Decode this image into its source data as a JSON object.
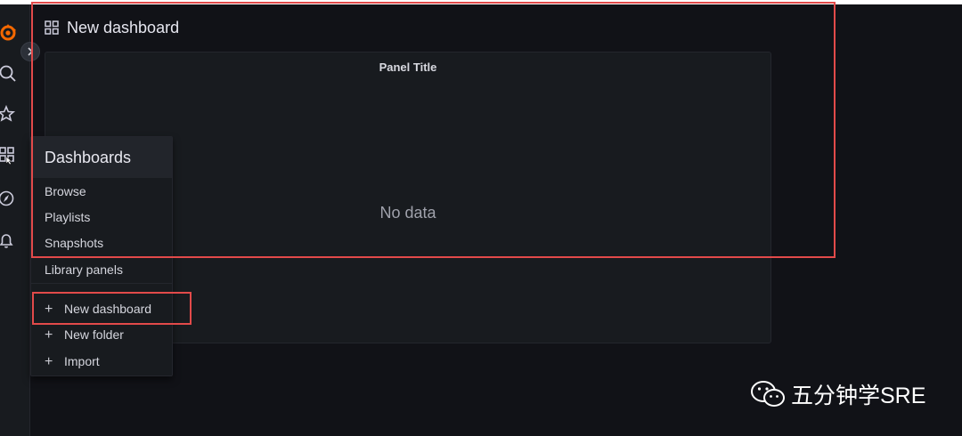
{
  "header": {
    "title": "New dashboard"
  },
  "panel": {
    "title": "Panel Title",
    "empty_text": "No data"
  },
  "sidebar": {
    "icons": [
      "grafana-logo-icon",
      "search-icon",
      "star-icon",
      "dashboards-icon",
      "explore-icon",
      "alerting-bell-icon"
    ],
    "expand_icon": "chevron-right-icon"
  },
  "menu": {
    "header": "Dashboards",
    "items": [
      "Browse",
      "Playlists",
      "Snapshots",
      "Library panels"
    ],
    "actions": [
      {
        "label": "New dashboard",
        "icon": "+"
      },
      {
        "label": "New folder",
        "icon": "+"
      },
      {
        "label": "Import",
        "icon": "+"
      }
    ]
  },
  "watermark": {
    "text": "五分钟学SRE"
  },
  "colors": {
    "accent_logo": "#f46800",
    "highlight": "#e24a4a",
    "background": "#111217",
    "panel": "#181b1f"
  }
}
